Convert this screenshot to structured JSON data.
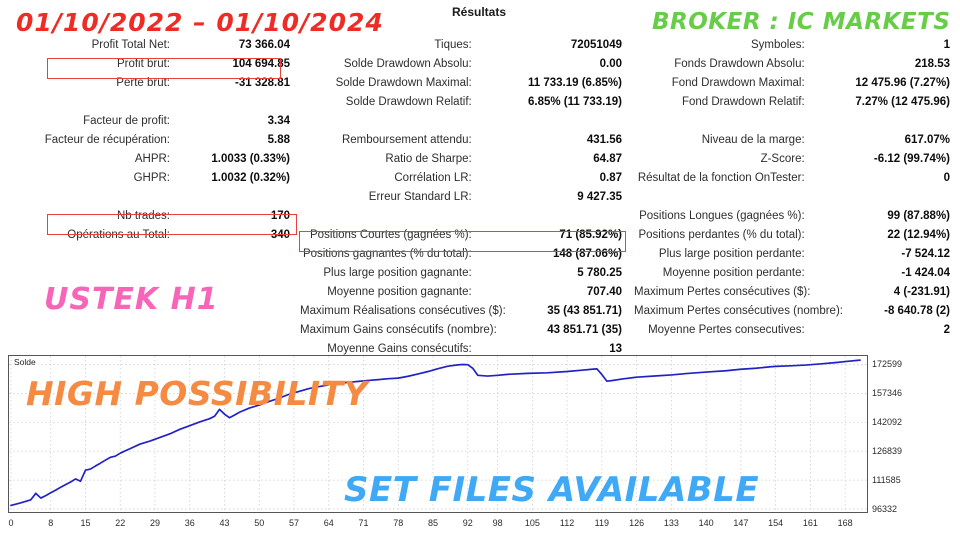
{
  "report": {
    "title": "Résultats"
  },
  "overlays": {
    "dates": "01/10/2022  –  01/10/2024",
    "broker": "BROKER : IC MARKETS",
    "pair_timeframe": "USTEK H1",
    "tagline": "HIGH POSSIBILITY",
    "set_files": "SET FILES AVAILABLE",
    "colors": {
      "dates": "#ee2b24",
      "broker": "#67cc48",
      "pair_timeframe": "#f765b8",
      "tagline": "#f58b42",
      "set_files": "#3fa9f5",
      "highlight_box": "#e8403a",
      "equity_line": "#2222c4"
    }
  },
  "stats": {
    "left": [
      {
        "label": "Profit Total Net:",
        "value": "73 366.04",
        "highlighted": true
      },
      {
        "label": "Profit brut:",
        "value": "104 694.85"
      },
      {
        "label": "Perte brut:",
        "value": "-31 328.81"
      },
      {
        "label": "",
        "value": ""
      },
      {
        "label": "Facteur de profit:",
        "value": "3.34"
      },
      {
        "label": "Facteur de récupération:",
        "value": "5.88"
      },
      {
        "label": "AHPR:",
        "value": "1.0033 (0.33%)"
      },
      {
        "label": "GHPR:",
        "value": "1.0032 (0.32%)"
      },
      {
        "label": "",
        "value": ""
      },
      {
        "label": "Nb trades:",
        "value": "170",
        "highlighted": true
      },
      {
        "label": "Opérations au Total:",
        "value": "340"
      }
    ],
    "middle": [
      {
        "label": "Tiques:",
        "value": "72051049"
      },
      {
        "label": "Solde Drawdown Absolu:",
        "value": "0.00"
      },
      {
        "label": "Solde Drawdown Maximal:",
        "value": "11 733.19 (6.85%)"
      },
      {
        "label": "Solde Drawdown Relatif:",
        "value": "6.85% (11 733.19)"
      },
      {
        "label": "",
        "value": ""
      },
      {
        "label": "Remboursement attendu:",
        "value": "431.56"
      },
      {
        "label": "Ratio de Sharpe:",
        "value": "64.87"
      },
      {
        "label": "Corrélation LR:",
        "value": "0.87"
      },
      {
        "label": "Erreur Standard LR:",
        "value": "9 427.35"
      },
      {
        "label": "",
        "value": ""
      },
      {
        "label": "Positions Courtes (gagnées %):",
        "value": "71 (85.92%)"
      },
      {
        "label": "Positions gagnantes (% du total):",
        "value": "148 (87.06%)",
        "highlighted": true
      },
      {
        "label": "Plus large position gagnante:",
        "value": "5 780.25"
      },
      {
        "label": "Moyenne position gagnante:",
        "value": "707.40"
      },
      {
        "label": "Maximum Réalisations consécutives ($):",
        "value": "35 (43 851.71)"
      },
      {
        "label": "Maximum Gains consécutifs (nombre):",
        "value": "43 851.71 (35)"
      },
      {
        "label": "Moyenne Gains consécutifs:",
        "value": "13"
      }
    ],
    "right": [
      {
        "label": "Symboles:",
        "value": "1"
      },
      {
        "label": "Fonds Drawdown Absolu:",
        "value": "218.53"
      },
      {
        "label": "Fond Drawdown Maximal:",
        "value": "12 475.96 (7.27%)"
      },
      {
        "label": "Fond Drawdown Relatif:",
        "value": "7.27% (12 475.96)"
      },
      {
        "label": "",
        "value": ""
      },
      {
        "label": "Niveau de la marge:",
        "value": "617.07%"
      },
      {
        "label": "Z-Score:",
        "value": "-6.12 (99.74%)"
      },
      {
        "label": "Résultat de la fonction OnTester:",
        "value": "0"
      },
      {
        "label": "",
        "value": ""
      },
      {
        "label": "Positions Longues (gagnées %):",
        "value": "99 (87.88%)"
      },
      {
        "label": "Positions perdantes (% du total):",
        "value": "22 (12.94%)"
      },
      {
        "label": "Plus large position perdante:",
        "value": "-7 524.12"
      },
      {
        "label": "Moyenne position perdante:",
        "value": "-1 424.04"
      },
      {
        "label": "Maximum Pertes consécutives ($):",
        "value": "4 (-231.91)"
      },
      {
        "label": "Maximum Pertes consécutives (nombre):",
        "value": "-8 640.78 (2)"
      },
      {
        "label": "Moyenne Pertes consecutives:",
        "value": "2"
      }
    ]
  },
  "chart_data": {
    "type": "line",
    "title": "",
    "series_label": "Solde",
    "xlabel": "",
    "ylabel": "",
    "grid": true,
    "legend_position": "top-left",
    "xticks": [
      0,
      8,
      15,
      22,
      29,
      36,
      43,
      50,
      57,
      64,
      71,
      78,
      85,
      92,
      98,
      105,
      112,
      119,
      126,
      133,
      140,
      147,
      154,
      161,
      168
    ],
    "yticks": [
      96332,
      111585,
      126839,
      142092,
      157346,
      172599
    ],
    "xlim": [
      0,
      172
    ],
    "ylim": [
      96332,
      175500
    ],
    "series": [
      {
        "name": "Solde",
        "color": "#2222c4",
        "x": [
          0,
          2,
          4,
          5,
          6,
          7,
          8,
          9,
          10,
          12,
          13,
          14,
          15,
          16,
          17,
          18,
          19,
          20,
          21,
          22,
          24,
          26,
          28,
          30,
          32,
          34,
          36,
          38,
          40,
          41,
          42,
          43,
          44,
          45,
          46,
          48,
          50,
          52,
          54,
          56,
          58,
          60,
          62,
          64,
          66,
          68,
          70,
          72,
          74,
          76,
          78,
          80,
          82,
          84,
          86,
          88,
          90,
          91,
          92,
          93,
          94,
          96,
          98,
          100,
          104,
          108,
          112,
          115,
          117,
          118,
          119,
          120,
          121,
          123,
          126,
          130,
          133,
          136,
          140,
          144,
          147,
          150,
          153,
          154,
          157,
          160,
          163,
          166,
          169,
          171
        ],
        "y": [
          98200,
          99600,
          101200,
          104600,
          102100,
          103400,
          104900,
          106300,
          107800,
          110600,
          112200,
          111000,
          116800,
          117400,
          119000,
          120500,
          122100,
          123600,
          124200,
          125800,
          128200,
          130600,
          132200,
          134100,
          136000,
          138400,
          140300,
          142300,
          144000,
          145300,
          148900,
          146400,
          144500,
          145900,
          147400,
          149600,
          151200,
          153100,
          154800,
          156900,
          158400,
          159900,
          160900,
          161900,
          162600,
          163200,
          163700,
          164200,
          164600,
          165100,
          165400,
          166400,
          167600,
          168900,
          170400,
          171700,
          172400,
          172600,
          172500,
          170600,
          166900,
          166500,
          166900,
          167400,
          167900,
          168200,
          168900,
          169600,
          170100,
          170300,
          167300,
          163800,
          164100,
          164900,
          165900,
          166600,
          167100,
          167800,
          168600,
          169300,
          170100,
          170600,
          171400,
          171600,
          171900,
          172300,
          172900,
          173600,
          174400,
          174900
        ]
      }
    ]
  }
}
